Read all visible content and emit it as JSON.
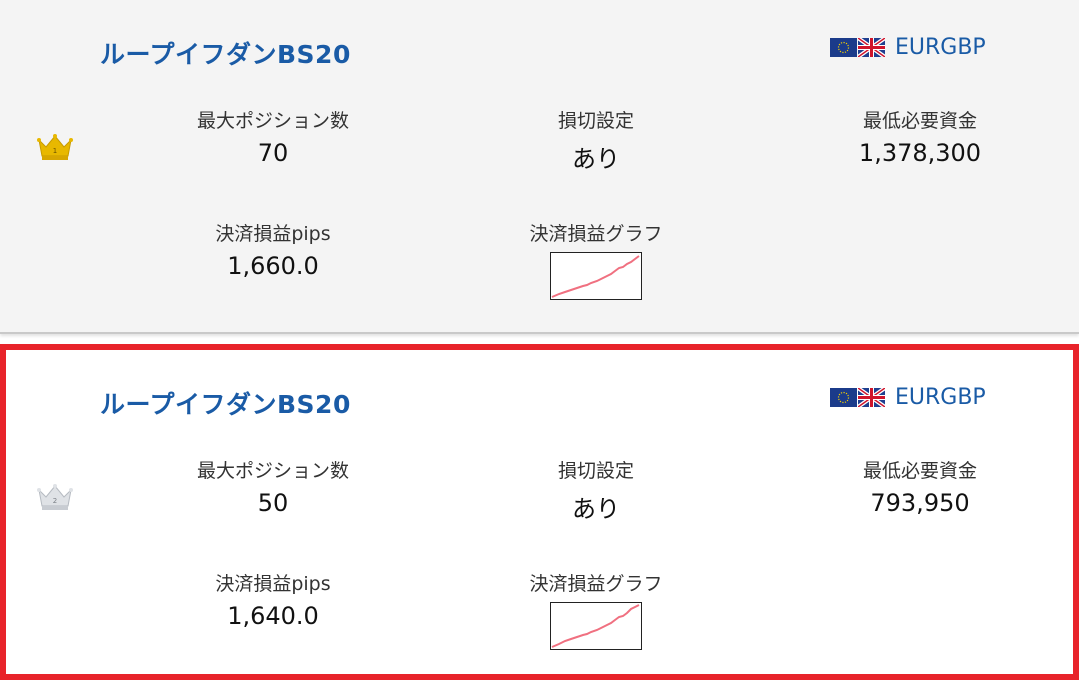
{
  "cards": [
    {
      "rank": "1",
      "crown_color": "gold",
      "title": "ループイフダンBS20",
      "pair": "EURGBP",
      "stats": {
        "max_positions": {
          "label": "最大ポジション数",
          "value": "70"
        },
        "stop_loss": {
          "label": "損切設定",
          "value": "あり"
        },
        "min_capital": {
          "label": "最低必要資金",
          "value": "1,378,300"
        },
        "pips": {
          "label": "決済損益pips",
          "value": "1,660.0"
        },
        "graph": {
          "label": "決済損益グラフ"
        }
      },
      "selected": false
    },
    {
      "rank": "2",
      "crown_color": "silver",
      "title": "ループイフダンBS20",
      "pair": "EURGBP",
      "stats": {
        "max_positions": {
          "label": "最大ポジション数",
          "value": "50"
        },
        "stop_loss": {
          "label": "損切設定",
          "value": "あり"
        },
        "min_capital": {
          "label": "最低必要資金",
          "value": "793,950"
        },
        "pips": {
          "label": "決済損益pips",
          "value": "1,640.0"
        },
        "graph": {
          "label": "決済損益グラフ"
        }
      },
      "selected": true
    }
  ],
  "colors": {
    "title": "#1a5ba6",
    "selection_border": "#e8232a",
    "graph_line": "#f07080",
    "crown_gold": "#e8b800",
    "crown_silver": "#c8ccd2"
  }
}
